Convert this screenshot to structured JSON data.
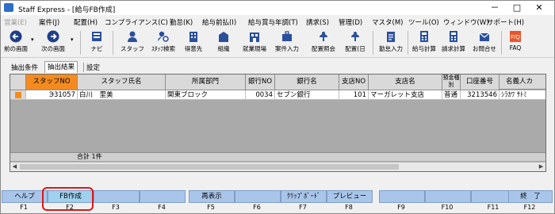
{
  "window": {
    "title": "Staff Express - [給与FB作成]",
    "controls": [
      "－",
      "□",
      "✕"
    ]
  },
  "menu": [
    {
      "label": "営業(E)",
      "enabled": false
    },
    {
      "label": "案件(J)",
      "enabled": true
    },
    {
      "label": "配置(H)",
      "enabled": true
    },
    {
      "label": "コンプライアンス(C)",
      "enabled": true
    },
    {
      "label": "勤怠(K)",
      "enabled": true
    },
    {
      "label": "給与前払(I)",
      "enabled": true
    },
    {
      "label": "給与賞与年調(T)",
      "enabled": true
    },
    {
      "label": "請求(S)",
      "enabled": true
    },
    {
      "label": "管理(D)",
      "enabled": true
    },
    {
      "label": "マスタ(M)",
      "enabled": true
    },
    {
      "label": "ツール(O)",
      "enabled": true
    },
    {
      "label": "ウィンドウ(W)",
      "enabled": true
    },
    {
      "label": "サポート(H)",
      "enabled": true
    }
  ],
  "toolbar": [
    {
      "label": "前の画面",
      "icon": "back-arrow-icon"
    },
    {
      "label": "次の画面",
      "icon": "forward-arrow-icon"
    },
    {
      "label": "ナビ",
      "icon": "navi-icon"
    },
    {
      "label": "スタッフ",
      "icon": "staff-icon"
    },
    {
      "label": "ｽﾀｯﾌ検索",
      "icon": "staff-search-icon"
    },
    {
      "label": "得意先",
      "icon": "customer-icon"
    },
    {
      "label": "組織",
      "icon": "organization-icon"
    },
    {
      "label": "就業現場",
      "icon": "worksite-icon"
    },
    {
      "label": "案件入力",
      "icon": "case-entry-icon"
    },
    {
      "label": "配置照会",
      "icon": "placement-inquiry-icon"
    },
    {
      "label": "配置(日",
      "icon": "placement-daily-icon"
    },
    {
      "label": "勤怠入力",
      "icon": "attendance-entry-icon"
    },
    {
      "label": "給与計算",
      "icon": "payroll-calc-icon"
    },
    {
      "label": "請求計算",
      "icon": "billing-calc-icon"
    },
    {
      "label": "お問合せ",
      "icon": "inquiry-icon"
    },
    {
      "label": "FAQ",
      "icon": "faq-icon"
    }
  ],
  "tabs": [
    "抽出条件",
    "抽出結果",
    "設定"
  ],
  "active_tab": "抽出結果",
  "grid": {
    "columns": [
      "スタッフNO",
      "スタッフ氏名",
      "所属部門",
      "銀行NO",
      "銀行名",
      "支店NO",
      "支店名",
      "預金種別",
      "口座番号",
      "名義人カ"
    ],
    "rows": [
      {
        "staff_no": "Э31057",
        "staff_name": "白川　里美",
        "department": "関東ブロック",
        "bank_no": "0034",
        "bank_name": "セブン銀行",
        "branch_no": "101",
        "branch_name": "マーガレット支店",
        "deposit_type": "普通",
        "account_no": "3213546",
        "holder_kana": "ｼﾗｶﾜ ｻﾄﾐ"
      }
    ],
    "total_label": "合計  1件"
  },
  "fkeys": [
    {
      "label": "ヘルプ",
      "key": "F1"
    },
    {
      "label": "FB作成",
      "key": "F2"
    },
    {
      "label": "",
      "key": "F3"
    },
    {
      "label": "",
      "key": "F4"
    },
    {
      "label": "再表示",
      "key": "F5"
    },
    {
      "label": "",
      "key": "F6"
    },
    {
      "label": "ｸﾘｯﾌﾟﾎﾞｰﾄﾞ",
      "key": "F7"
    },
    {
      "label": "プレビュー",
      "key": "F8"
    },
    {
      "label": "",
      "key": "F9"
    },
    {
      "label": "",
      "key": "F10"
    },
    {
      "label": "",
      "key": "F11"
    },
    {
      "label": "終　了",
      "key": "F12"
    }
  ],
  "colors": {
    "header_highlight": "#f58b1f",
    "fkey_bg": "#a9c6ea",
    "highlight_box": "#e01616"
  }
}
